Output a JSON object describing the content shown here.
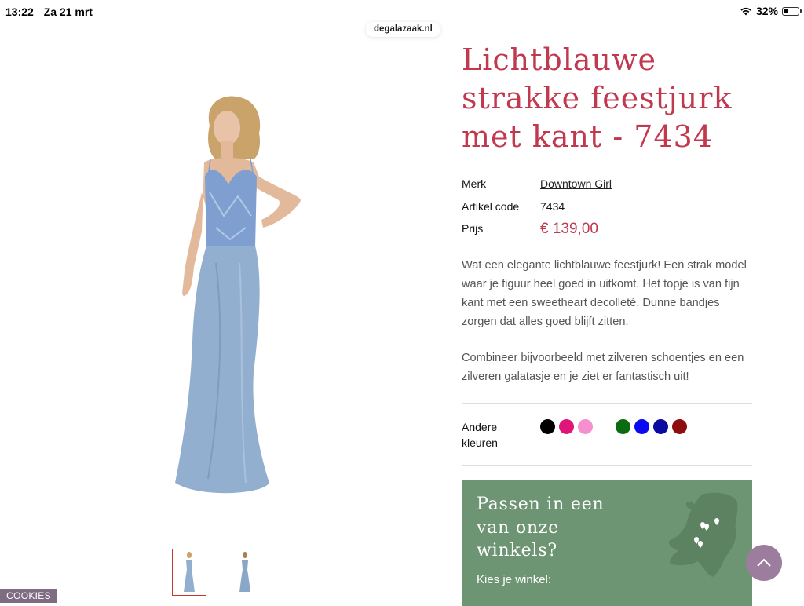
{
  "status_bar": {
    "time": "13:22",
    "date": "Za 21 mrt",
    "battery": "32%"
  },
  "browser": {
    "url": "degalazaak.nl"
  },
  "product": {
    "title": "Lichtblauwe strakke feestjurk met kant - 7434",
    "specs": {
      "brand_label": "Merk",
      "brand_value": "Downtown Girl",
      "code_label": "Artikel code",
      "code_value": "7434",
      "price_label": "Prijs",
      "price_value": "€ 139,00"
    },
    "description": [
      "Wat een elegante lichtblauwe feestjurk! Een strak model waar je figuur heel goed in uitkomt. Het topje is van fijn kant met een sweetheart decolleté. Dunne bandjes zorgen dat alles goed blijft zitten.",
      "Combineer bijvoorbeeld met zilveren schoentjes en een zilveren galatasje en je ziet er fantastisch uit!"
    ],
    "other_colors_label": "Andere kleuren",
    "other_colors": [
      "#000000",
      "#e0157a",
      "#f58fd0",
      "#ffffff",
      "#0b6b13",
      "#0a0af0",
      "#0a0aa0",
      "#8e0e0e"
    ],
    "dress_color": "#93afd0"
  },
  "store_box": {
    "title": "Passen in een van onze winkels?",
    "subtitle": "Kies je winkel:",
    "background": "#6d9473"
  },
  "cookies_label": "COOKIES",
  "accent_color": "#c0394f"
}
